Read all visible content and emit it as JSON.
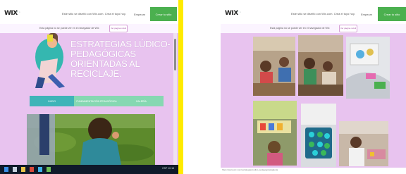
{
  "left_screen": {
    "wix_header": {
      "logo": "WIX",
      "message": "Este sitio se diseñó con Wix.com. Crea el tuyo hoy.",
      "start_link": "Empezar",
      "cta_label": "Crear tu sitio"
    },
    "notice": {
      "text": "Esta página no se puede ver en el navegador de Wix",
      "pill": "Ver página móvil"
    },
    "page": {
      "title": "ESTRATEGIAS LÚDICO-PEDAGÓGICAS ORIENTADAS AL RECICLAJE.",
      "nav_tabs": [
        "INICIO",
        "FUNDAMENTACIÓN PEDAGÓGICA",
        "GALERÍA"
      ]
    },
    "taskbar": {
      "tray_text": "ESP 10:18"
    }
  },
  "right_screen": {
    "wix_header": {
      "logo": "WIX",
      "message": "Este sitio se diseñó con Wix.com. Crea el tuyo hoy.",
      "start_link": "Empezar",
      "cta_label": "Crear tu sitio"
    },
    "notice": {
      "text": "Esta página no se puede ver en el navegador de Wix",
      "pill": "Ver página móvil"
    },
    "url_text": "https://www.wix.com/estrategias-ludico-pedagogicas/galeria"
  },
  "colors": {
    "page_background": "#e8c3ef",
    "separator": "#ffeb00",
    "cta_green": "#4bb04f",
    "tab_teal": "#3fb4b8",
    "tab_mint": "#86d8b2",
    "taskbar": "#0f1a2a"
  }
}
